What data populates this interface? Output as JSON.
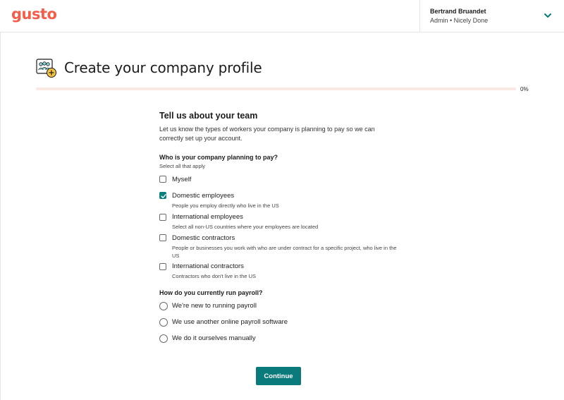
{
  "header": {
    "logo_text": "gusto",
    "user_name": "Bertrand Bruandet",
    "user_role": "Admin • Nicely Done",
    "brand_color": "#f45d48"
  },
  "page": {
    "title": "Create your company profile",
    "progress_label": "0%",
    "progress_fraction": 0.0
  },
  "team": {
    "heading": "Tell us about your team",
    "description": "Let us know the types of workers your company is planning to pay so we can correctly set up your account."
  },
  "workers_question": {
    "title": "Who is your company planning to pay?",
    "subtitle": "Select all that apply",
    "options": [
      {
        "label": "Myself",
        "description": "",
        "checked": false
      },
      {
        "label": "Domestic employees",
        "description": "People you employ directly who live in the US",
        "checked": true
      },
      {
        "label": "International employees",
        "description": "Select all non-US countries where your employees are located",
        "checked": false
      },
      {
        "label": "Domestic contractors",
        "description": "People or businesses you work with who are under contract for a specific project, who live in the US",
        "checked": false
      },
      {
        "label": "International contractors",
        "description": "Contractors who don't live in the US",
        "checked": false
      }
    ]
  },
  "payroll_question": {
    "title": "How do you currently run payroll?",
    "options": [
      {
        "label": "We're new to running payroll",
        "selected": false
      },
      {
        "label": "We use another online payroll software",
        "selected": false
      },
      {
        "label": "We do it ourselves manually",
        "selected": false
      }
    ]
  },
  "actions": {
    "continue_label": "Continue",
    "accent_color": "#0a7a7a"
  }
}
